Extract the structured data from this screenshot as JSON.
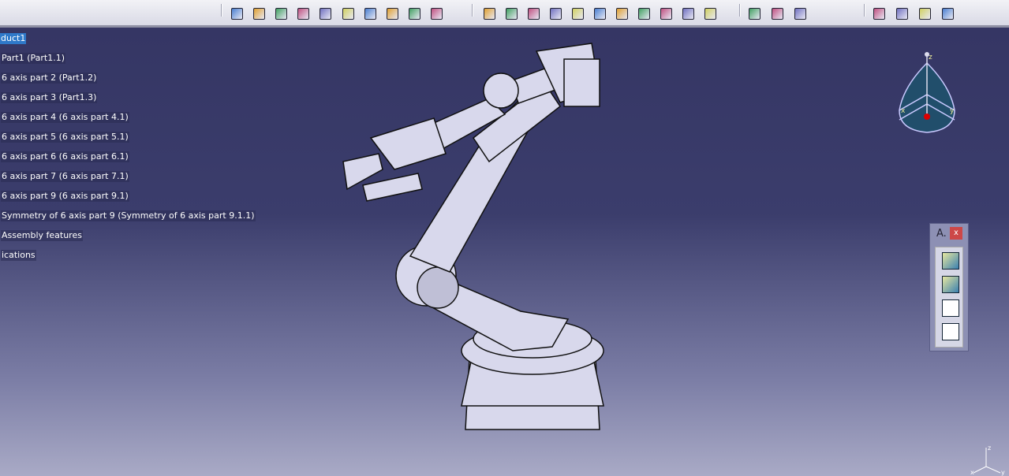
{
  "toolbar": {
    "groups": [
      {
        "icons": [
          "manipulation-icon",
          "explode-icon",
          "clash-icon",
          "sectioning-icon",
          "anchor-icon",
          "clip-icon",
          "measure-icon",
          "snap-icon",
          "disabled-constraint-icon",
          "fix-together-icon"
        ]
      },
      {
        "icons": [
          "new-component-icon",
          "new-product-icon",
          "new-part-icon",
          "existing-component-icon",
          "existing-component-positioning-icon",
          "replace-component-icon",
          "graph-tree-reordering-icon",
          "generate-numbering-icon",
          "selective-load-icon",
          "manage-representations-icon",
          "multi-instantiation-icon"
        ]
      },
      {
        "icons": [
          "publish-icon",
          "reuse-publication-icon",
          "update-publication-icon"
        ]
      },
      {
        "icons": [
          "scene-icon",
          "catalog-icon",
          "fit-all-icon",
          "enhanced-scene-icon"
        ]
      }
    ]
  },
  "tree": {
    "items": [
      {
        "label": "duct1",
        "selected": true
      },
      {
        "label": "Part1 (Part1.1)"
      },
      {
        "label": "6 axis part 2 (Part1.2)"
      },
      {
        "label": "6 axis part 3 (Part1.3)"
      },
      {
        "label": "6 axis part 4 (6 axis part 4.1)"
      },
      {
        "label": "6 axis part 5 (6 axis part 5.1)"
      },
      {
        "label": "6 axis part 6 (6 axis part 6.1)"
      },
      {
        "label": "6 axis part 7 (6 axis part 7.1)"
      },
      {
        "label": "6 axis part 9 (6 axis part 9.1)"
      },
      {
        "label": "Symmetry of 6 axis part 9 (Symmetry of 6 axis part 9.1.1)"
      },
      {
        "label": "Assembly features"
      },
      {
        "label": "ications"
      }
    ]
  },
  "compass": {
    "z": "z",
    "x": "x",
    "y": "y"
  },
  "panel": {
    "title": "A.",
    "close": "x",
    "icons": [
      "assembly-feature-icon",
      "split-icon",
      "tree-icon",
      "tree-red-icon"
    ]
  },
  "colors": {
    "background_top": "#343563",
    "background_bottom": "#a9aac6",
    "selection": "#2f79c9",
    "model": "#d8d8ec"
  }
}
